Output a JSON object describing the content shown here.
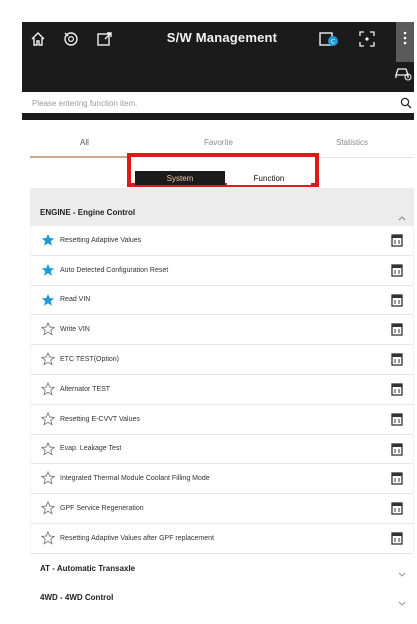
{
  "header": {
    "title": "S/W Management",
    "icons": [
      "home-icon",
      "dtc-icon",
      "export-icon",
      "ccs-icon",
      "capture-icon",
      "more-vertical-icon",
      "vehicle-icon"
    ]
  },
  "search": {
    "placeholder": "Please entering function item."
  },
  "tabs": [
    {
      "label": "All",
      "active": true
    },
    {
      "label": "Favorite",
      "active": false
    },
    {
      "label": "Statistics",
      "active": false
    }
  ],
  "segment": {
    "system": "System",
    "function": "Function",
    "selected": "System"
  },
  "sections": [
    {
      "title": "ENGINE - Engine Control",
      "expanded": true,
      "items": [
        {
          "label": "Resetting Adaptive Values",
          "favorite": true
        },
        {
          "label": "Auto Detected Configuration Reset",
          "favorite": true
        },
        {
          "label": "Read VIN",
          "favorite": true
        },
        {
          "label": "Write VIN",
          "favorite": false
        },
        {
          "label": "ETC TEST(Option)",
          "favorite": false
        },
        {
          "label": "Alternator TEST",
          "favorite": false
        },
        {
          "label": "Resetting E-CVVT Values",
          "favorite": false
        },
        {
          "label": "Evap. Leakage Test",
          "favorite": false
        },
        {
          "label": "Integrated Thermal Module Coolant Filling Mode",
          "favorite": false
        },
        {
          "label": "GPF Service Regeneration",
          "favorite": false
        },
        {
          "label": "Resetting Adaptive Values after GPF replacement",
          "favorite": false
        }
      ]
    },
    {
      "title": "AT - Automatic Transaxle",
      "expanded": false
    },
    {
      "title": "4WD - 4WD Control",
      "expanded": false
    }
  ],
  "colors": {
    "topbar": "#1b1b1b",
    "favorite_star": "#1e9bd7",
    "highlight_box": "#e01818",
    "segment_selected_text": "#f2c9a2",
    "tab_underline": "#c9a98c"
  }
}
